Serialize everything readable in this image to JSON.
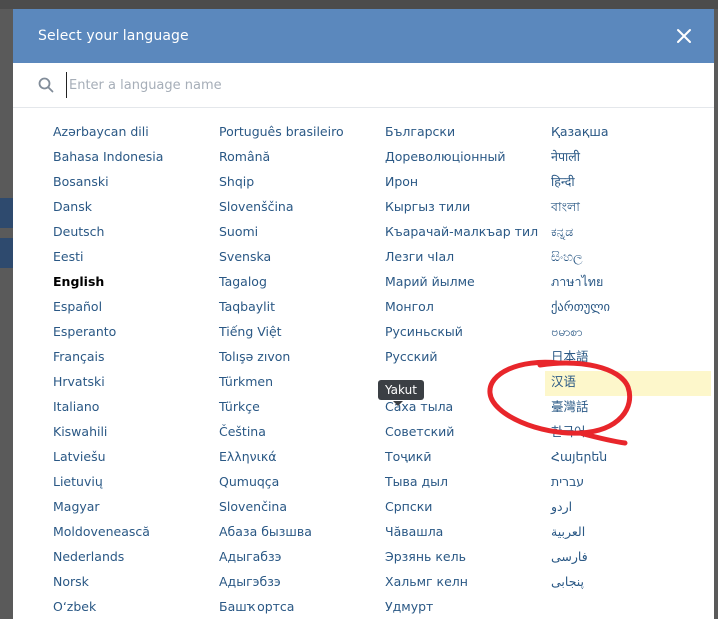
{
  "dialog": {
    "title": "Select your language",
    "close_label": "×"
  },
  "search": {
    "placeholder": "Enter a language name",
    "value": ""
  },
  "columns": [
    [
      "Azərbaycan dili",
      "Bahasa Indonesia",
      "Bosanski",
      "Dansk",
      "Deutsch",
      "Eesti",
      "English",
      "Español",
      "Esperanto",
      "Français",
      "Hrvatski",
      "Italiano",
      "Kiswahili",
      "Latviešu",
      "Lietuvių",
      "Magyar",
      "Moldovenească",
      "Nederlands",
      "Norsk",
      "O‘zbek"
    ],
    [
      "Português brasileiro",
      "Română",
      "Shqip",
      "Slovenščina",
      "Suomi",
      "Svenska",
      "Tagalog",
      "Taqbaylit",
      "Tiếng Việt",
      "Tolışə zıvon",
      "Türkmen",
      "Türkçe",
      "Čeština",
      "Ελληνικά",
      "Qumuqça",
      "Slovenčina",
      "Абаза бызшва",
      "Адыгабзэ",
      "Адыгэбзэ",
      "Башҡортса"
    ],
    [
      "Български",
      "Дореволюціонный",
      "Ирон",
      "Кыргыз тили",
      "Къарачай-малкъар тил",
      "Лезги чIал",
      "Марий йылме",
      "Монгол",
      "Русиньскый",
      "Русский",
      "Саха тыла",
      "Саха тыла",
      "Советский",
      "Тоҷикӣ",
      "Тыва дыл",
      "Српски",
      "Чăвашла",
      "Эрзянь кель",
      "Хальмг келн",
      "Удмурт"
    ],
    [
      "Қазақша",
      "नेपाली",
      "हिन्दी",
      "বাংলা",
      "ಕನ್ನಡ",
      "සිංහල",
      "ภาษาไทย",
      "ქართული",
      "ဗမာစာ",
      "日本語",
      "汉语",
      "臺灣話",
      "한국어",
      "Հայերեն",
      "עברית",
      "اردو",
      "العربية",
      "فارسی",
      "پنجابی",
      ""
    ]
  ],
  "current_language": "English",
  "hovered_item": "Саха тыла",
  "highlighted_item": "汉语",
  "tooltip": {
    "text": "Yakut"
  },
  "colors": {
    "header_bg": "#5b88bd",
    "link": "#2a5885",
    "highlight_bg": "#fdf7cb",
    "tooltip_bg": "#3b3f44",
    "annotation": "#e8262b"
  }
}
